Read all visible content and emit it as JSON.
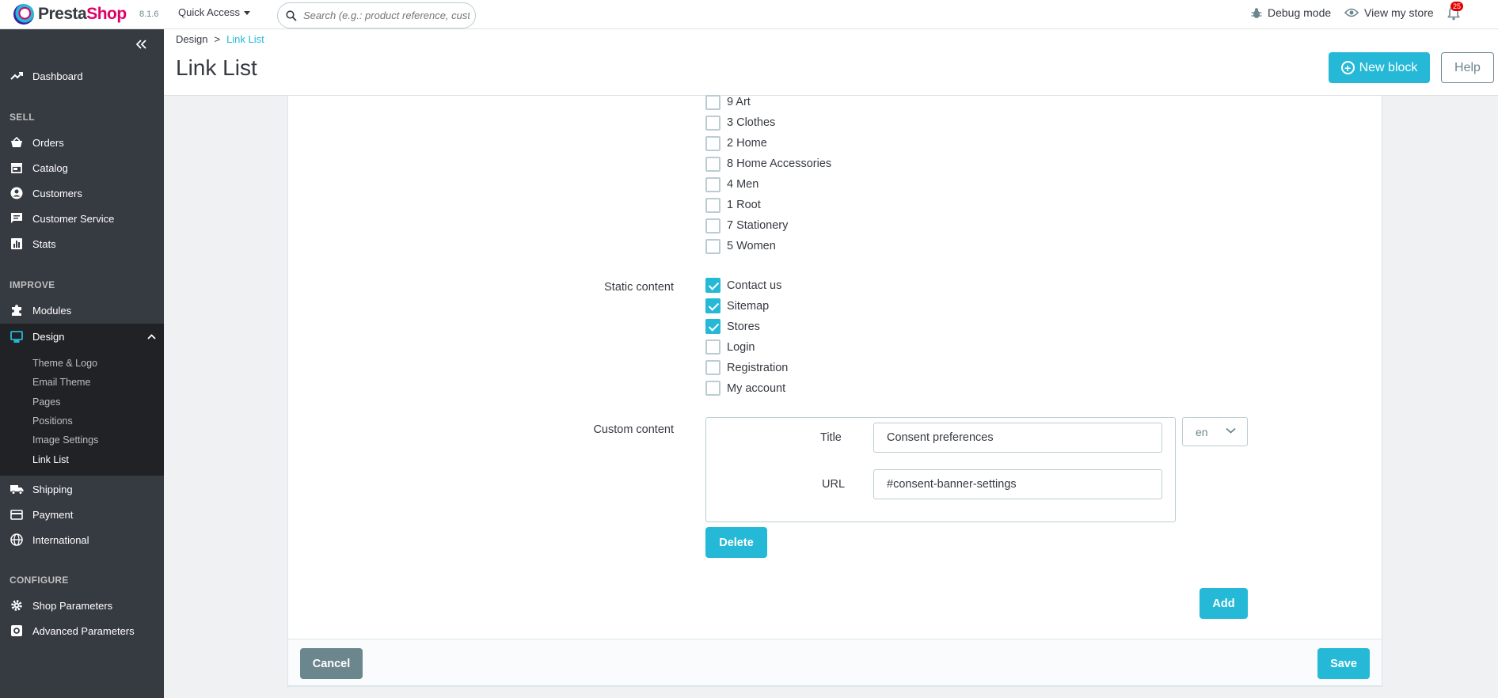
{
  "topbar": {
    "brand_part1": "Presta",
    "brand_part2": "Shop",
    "version": "8.1.6",
    "quick_access": "Quick Access",
    "search_placeholder": "Search (e.g.: product reference, custon",
    "debug_mode": "Debug mode",
    "view_store": "View my store",
    "notifications_count": "25"
  },
  "sidebar": {
    "dashboard": "Dashboard",
    "sections": {
      "sell": "SELL",
      "improve": "IMPROVE",
      "configure": "CONFIGURE"
    },
    "sell_items": [
      "Orders",
      "Catalog",
      "Customers",
      "Customer Service",
      "Stats"
    ],
    "improve_items": [
      "Modules",
      "Design"
    ],
    "design_submenu": [
      "Theme & Logo",
      "Email Theme",
      "Pages",
      "Positions",
      "Image Settings",
      "Link List"
    ],
    "after_items": [
      "Shipping",
      "Payment",
      "International"
    ],
    "configure_items": [
      "Shop Parameters",
      "Advanced Parameters"
    ]
  },
  "header": {
    "breadcrumb_parent": "Design",
    "breadcrumb_sep": ">",
    "breadcrumb_current": "Link List",
    "title": "Link List",
    "new_block": "New block",
    "help": "Help"
  },
  "form": {
    "categories": [
      {
        "label": "9 Art",
        "checked": false
      },
      {
        "label": "3 Clothes",
        "checked": false
      },
      {
        "label": "2 Home",
        "checked": false
      },
      {
        "label": "8 Home Accessories",
        "checked": false
      },
      {
        "label": "4 Men",
        "checked": false
      },
      {
        "label": "1 Root",
        "checked": false
      },
      {
        "label": "7 Stationery",
        "checked": false
      },
      {
        "label": "5 Women",
        "checked": false
      }
    ],
    "static_content_label": "Static content",
    "static_content": [
      {
        "label": "Contact us",
        "checked": true
      },
      {
        "label": "Sitemap",
        "checked": true
      },
      {
        "label": "Stores",
        "checked": true
      },
      {
        "label": "Login",
        "checked": false
      },
      {
        "label": "Registration",
        "checked": false
      },
      {
        "label": "My account",
        "checked": false
      }
    ],
    "custom_content_label": "Custom content",
    "title_label": "Title",
    "title_value": "Consent preferences",
    "url_label": "URL",
    "url_value": "#consent-banner-settings",
    "language": "en",
    "delete": "Delete",
    "add": "Add",
    "cancel": "Cancel",
    "save": "Save"
  },
  "colors": {
    "accent": "#25b9d7",
    "sidebar_bg": "#363a41",
    "brand_pink": "#df0067"
  }
}
